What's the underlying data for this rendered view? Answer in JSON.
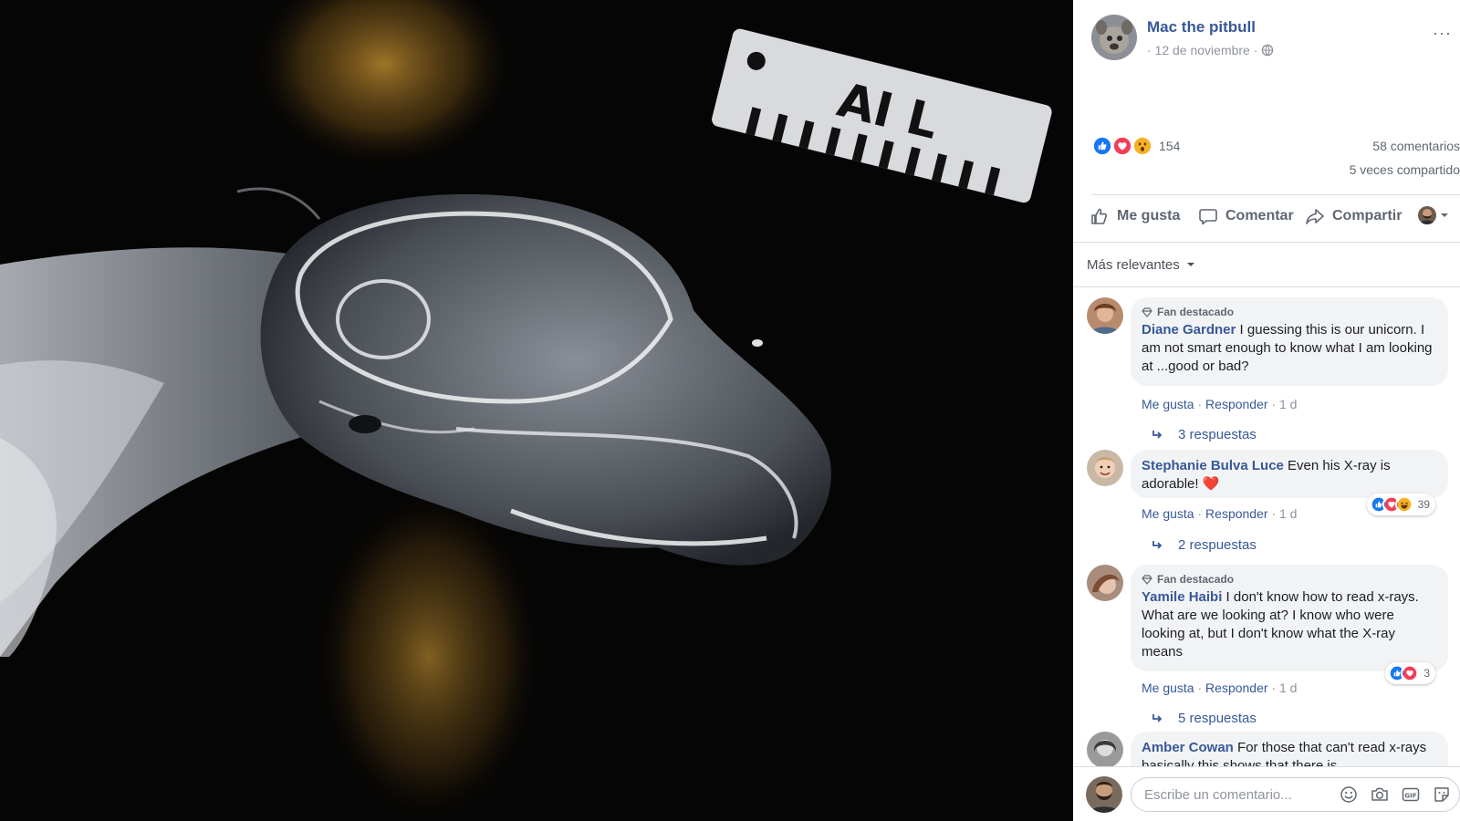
{
  "post": {
    "page_name": "Mac the pitbull",
    "date": "· 12 de noviembre ·",
    "more": "···",
    "reactions": {
      "count": "154",
      "types": [
        "like-icon",
        "love-icon",
        "wow-icon"
      ]
    },
    "comments_count": "58 comentarios",
    "shares_count": "5 veces compartido"
  },
  "photo": {
    "ruler_marker": "AI L"
  },
  "actions": {
    "like": "Me gusta",
    "comment": "Comentar",
    "share": "Compartir"
  },
  "sort": {
    "label": "Más relevantes"
  },
  "comments": [
    {
      "badge": "Fan destacado",
      "author": "Diane Gardner",
      "text": "I guessing this is our unicorn. I am not smart enough to know what I am looking at ...good or bad?",
      "like": "Me gusta",
      "reply": "Responder",
      "time": "1 d",
      "replies": "3 respuestas"
    },
    {
      "author": "Stephanie Bulva Luce",
      "text": "Even his X-ray is adorable! ❤️",
      "like": "Me gusta",
      "reply": "Responder",
      "time": "1 d",
      "reaction_count": "39",
      "replies": "2 respuestas"
    },
    {
      "badge": "Fan destacado",
      "author": "Yamile Haibi",
      "text": "I don't know how to read x-rays. What are we looking at? I know who were looking at, but I don't know what the X-ray means",
      "like": "Me gusta",
      "reply": "Responder",
      "time": "1 d",
      "reaction_count": "3",
      "replies": "5 respuestas"
    },
    {
      "author": "Amber Cowan",
      "text": "For those that can't read x-rays basically this shows that there is"
    }
  ],
  "composer": {
    "placeholder": "Escribe un comentario..."
  },
  "colors": {
    "link": "#385898",
    "like": "#1877f2",
    "love": "#f33e58",
    "wow": "#f7b125"
  }
}
